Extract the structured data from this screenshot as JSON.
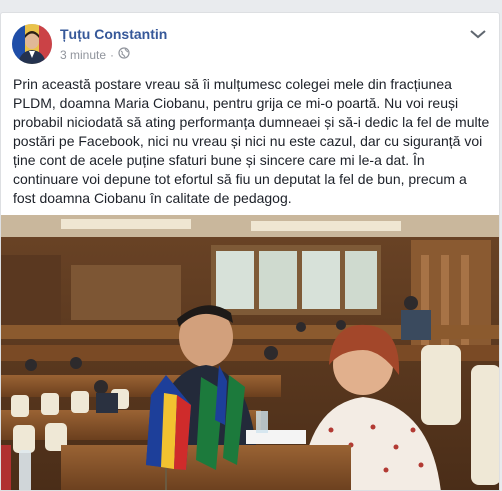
{
  "post": {
    "author": "Țuțu Constantin",
    "time": "3 minute",
    "privacy_sep": "·",
    "text": "Prin această postare vreau să îi mulțumesc colegei mele din fracțiunea PLDM, doamna Maria Ciobanu, pentru grija ce mi-o poartă. Nu voi reuși probabil niciodată să ating performanța dumneaei și să-i dedic la fel de multe postări pe Facebook, nici nu vreau și nici nu este cazul, dar cu siguranță voi ține cont de acele puține sfaturi bune și sincere care mi le-a dat. În continuare voi depune tot efortul să fiu un deputat la fel de bun, precum a fost doamna Ciobanu în calitate de pedagog."
  },
  "icons": {
    "globe": "globe-icon",
    "menu": "chevron-down-icon"
  },
  "colors": {
    "author_link": "#365899",
    "meta": "#90949c",
    "text": "#1d2129",
    "background": "#e9ebee"
  }
}
